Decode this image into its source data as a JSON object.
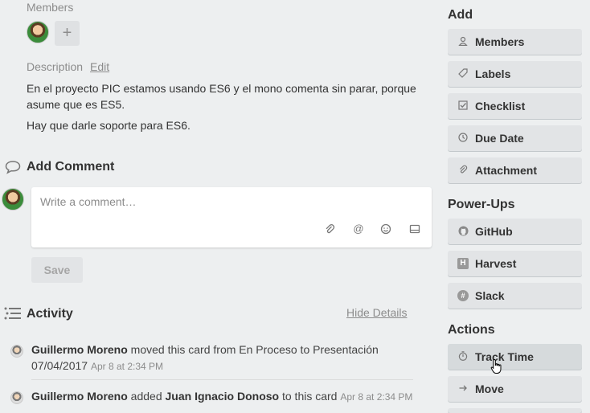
{
  "members": {
    "label": "Members",
    "add_symbol": "+"
  },
  "description": {
    "label": "Description",
    "edit_link": "Edit",
    "paragraphs": [
      "En el proyecto PIC estamos usando ES6 y el mono comenta sin parar, porque asume que es ES5.",
      "Hay que darle soporte para ES6."
    ]
  },
  "comment": {
    "title": "Add Comment",
    "placeholder": "Write a comment…",
    "save_label": "Save"
  },
  "activity": {
    "title": "Activity",
    "hide_details": "Hide Details",
    "items": [
      {
        "user": "Guillermo Moreno",
        "action": " moved this card from En Proceso to Presentación",
        "date_line": "07/04/2017",
        "time": "Apr 8 at 2:34 PM"
      },
      {
        "user": "Guillermo Moreno",
        "action_pre": " added ",
        "target": "Juan Ignacio Donoso",
        "action_post": " to this card",
        "time": "Apr 8 at 2:34 PM"
      }
    ]
  },
  "sidebar": {
    "add_header": "Add",
    "add_items": [
      {
        "label": "Members",
        "icon": "person-icon"
      },
      {
        "label": "Labels",
        "icon": "tag-icon"
      },
      {
        "label": "Checklist",
        "icon": "checkbox-icon"
      },
      {
        "label": "Due Date",
        "icon": "clock-icon"
      },
      {
        "label": "Attachment",
        "icon": "paperclip-icon"
      }
    ],
    "powerups_header": "Power-Ups",
    "powerups": [
      {
        "label": "GitHub",
        "icon": "github-icon"
      },
      {
        "label": "Harvest",
        "icon": "harvest-icon",
        "glyph": "H"
      },
      {
        "label": "Slack",
        "icon": "slack-icon",
        "glyph": "#"
      }
    ],
    "actions_header": "Actions",
    "actions": [
      {
        "label": "Track Time",
        "icon": "stopwatch-icon"
      },
      {
        "label": "Move",
        "icon": "arrow-right-icon"
      }
    ]
  }
}
